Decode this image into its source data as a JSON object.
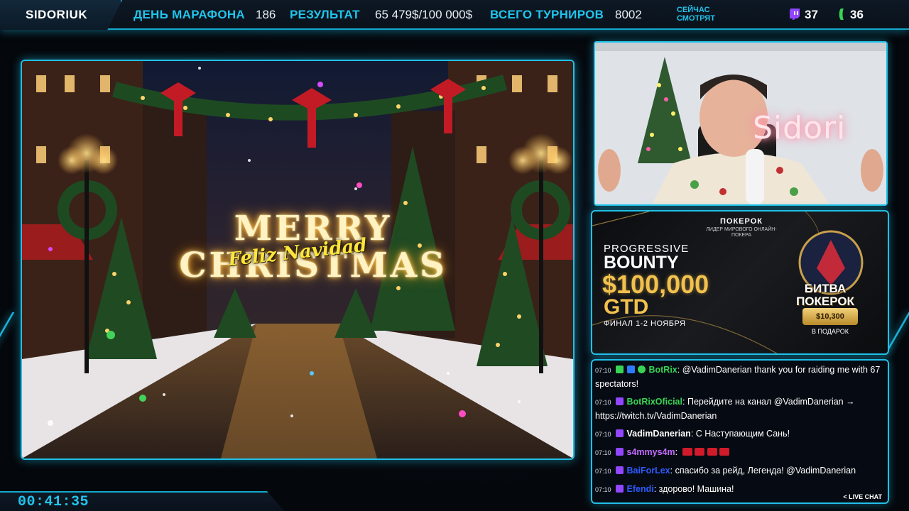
{
  "channel": {
    "name": "SIDORIUK"
  },
  "stats": {
    "marathon_day_label": "ДЕНЬ МАРАФОНА",
    "marathon_day_value": "186",
    "result_label": "РЕЗУЛЬТАТ",
    "result_value": "65 479$/100 000$",
    "tournaments_label": "ВСЕГО ТУРНИРОВ",
    "tournaments_value": "8002"
  },
  "viewers": {
    "label": "СЕЙЧАС СМОТРЯТ",
    "twitch_count": "37",
    "kick_count": "36"
  },
  "stream": {
    "title_line1": "MERRY",
    "title_line2": "CHRISTMAS",
    "subtitle": "Feliz Navidad"
  },
  "webcam": {
    "brand": "Sidori"
  },
  "ad": {
    "brand": "ПОКЕРОК",
    "brand_sub": "ЛИДЕР МИРОВОГО ОНЛАЙН-ПОКЕРА",
    "line1": "PROGRESSIVE",
    "line2": "BOUNTY",
    "amount": "$100,000",
    "gtd": "GTD",
    "final": "ФИНАЛ 1-2 НОЯБРЯ",
    "battle": "БИТВА ПОКЕРОК",
    "prize": "$10,300",
    "gift": "В ПОДАРОК"
  },
  "chat": {
    "messages": [
      {
        "time": "07:10",
        "user": "BotRix",
        "user_color": "#39d353",
        "text": "@VadimDanerian thank you for raiding me with 67 spectators!"
      },
      {
        "time": "07:10",
        "user": "BotRixOficial",
        "user_color": "#39d353",
        "text": "Перейдите на канал @VadimDanerian → https://twitch.tv/VadimDanerian"
      },
      {
        "time": "07:10",
        "user": "VadimDanerian",
        "user_color": "#ffffff",
        "text": "С Наступающим Сань!"
      },
      {
        "time": "07:10",
        "user": "s4mmys4m",
        "user_color": "#c46bff",
        "text": ""
      },
      {
        "time": "07:10",
        "user": "BaiForLex",
        "user_color": "#2d5bff",
        "text": "спасибо за рейд, Легенда! @VadimDanerian"
      },
      {
        "time": "07:10",
        "user": "Efendi",
        "user_color": "#2d5bff",
        "text": "здорово! Машина!"
      }
    ],
    "live_label": "< LIVE CHAT"
  },
  "timer": "00:41:35",
  "colors": {
    "accent": "#21c4ec",
    "gold": "#f2c14e"
  }
}
